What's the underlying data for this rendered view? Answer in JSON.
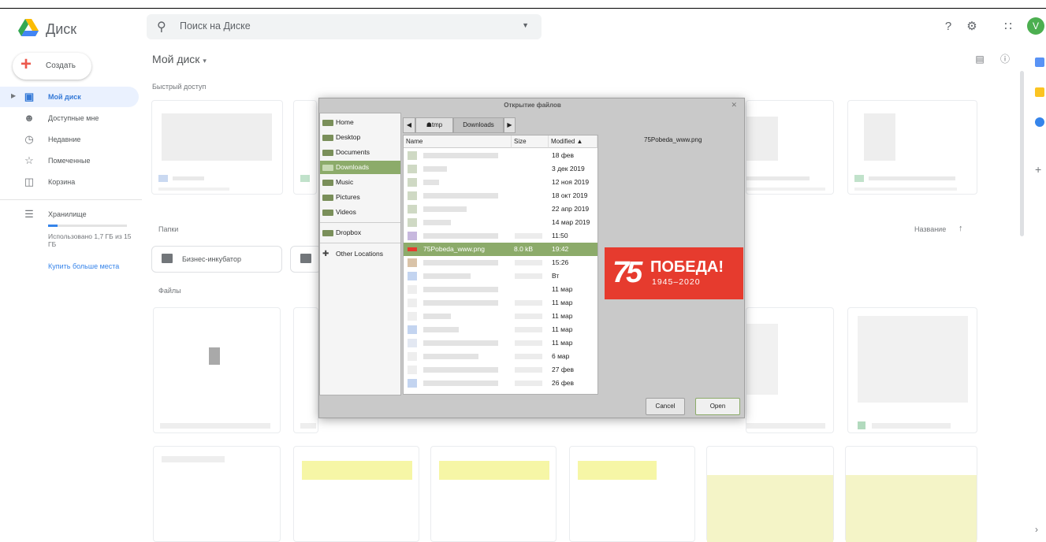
{
  "header": {
    "app_name": "Диск",
    "search_placeholder": "Поиск на Диске"
  },
  "avatar": {
    "initial": "V",
    "color": "#4caf50"
  },
  "sidebar": {
    "create_label": "Создать",
    "items": [
      {
        "label": "Мой диск",
        "icon": "drive-icon",
        "active": true
      },
      {
        "label": "Доступные мне",
        "icon": "people-icon"
      },
      {
        "label": "Недавние",
        "icon": "clock-icon"
      },
      {
        "label": "Помеченные",
        "icon": "star-icon"
      },
      {
        "label": "Корзина",
        "icon": "trash-icon"
      }
    ],
    "storage_label": "Хранилище",
    "usage_text": "Использовано 1,7 ГБ из 15 ГБ",
    "usage_fraction": 0.113,
    "buy_more": "Купить больше места"
  },
  "main": {
    "title": "Мой диск",
    "quick_access": "Быстрый доступ",
    "folders_label": "Папки",
    "folders": [
      {
        "name": "Бизнес-инкубатор"
      }
    ],
    "files_label": "Файлы",
    "sort_label": "Название"
  },
  "dialog": {
    "title": "Открытие файлов",
    "places": [
      {
        "label": "Home"
      },
      {
        "label": "Desktop"
      },
      {
        "label": "Documents"
      },
      {
        "label": "Downloads",
        "selected": true
      },
      {
        "label": "Music"
      },
      {
        "label": "Pictures"
      },
      {
        "label": "Videos"
      },
      {
        "label": "Dropbox"
      },
      {
        "label": "Other Locations"
      }
    ],
    "path": [
      "tmp",
      "Downloads"
    ],
    "columns": {
      "name": "Name",
      "size": "Size",
      "modified": "Modified"
    },
    "files": [
      {
        "modified": "18 фев"
      },
      {
        "modified": "3 дек 2019"
      },
      {
        "modified": "12 ноя 2019"
      },
      {
        "modified": "18 окт 2019"
      },
      {
        "modified": "22 апр 2019"
      },
      {
        "modified": "14 мар 2019"
      },
      {
        "modified": "11:50"
      },
      {
        "name": "75Pobeda_www.png",
        "size": "8.0 kB",
        "modified": "19:42",
        "selected": true
      },
      {
        "modified": "15:26"
      },
      {
        "modified": "Вт"
      },
      {
        "modified": "11 мар"
      },
      {
        "modified": "11 мар"
      },
      {
        "modified": "11 мар"
      },
      {
        "modified": "11 мар"
      },
      {
        "modified": "11 мар"
      },
      {
        "modified": "6 мар"
      },
      {
        "modified": "27 фев"
      },
      {
        "modified": "26 фев"
      }
    ],
    "preview": {
      "filename": "75Pobeda_www.png",
      "image_number": "75",
      "image_title": "ПОБЕДА!",
      "image_years": "1945–2020",
      "image_color": "#e63b2e"
    },
    "cancel_label": "Cancel",
    "open_label": "Open"
  }
}
